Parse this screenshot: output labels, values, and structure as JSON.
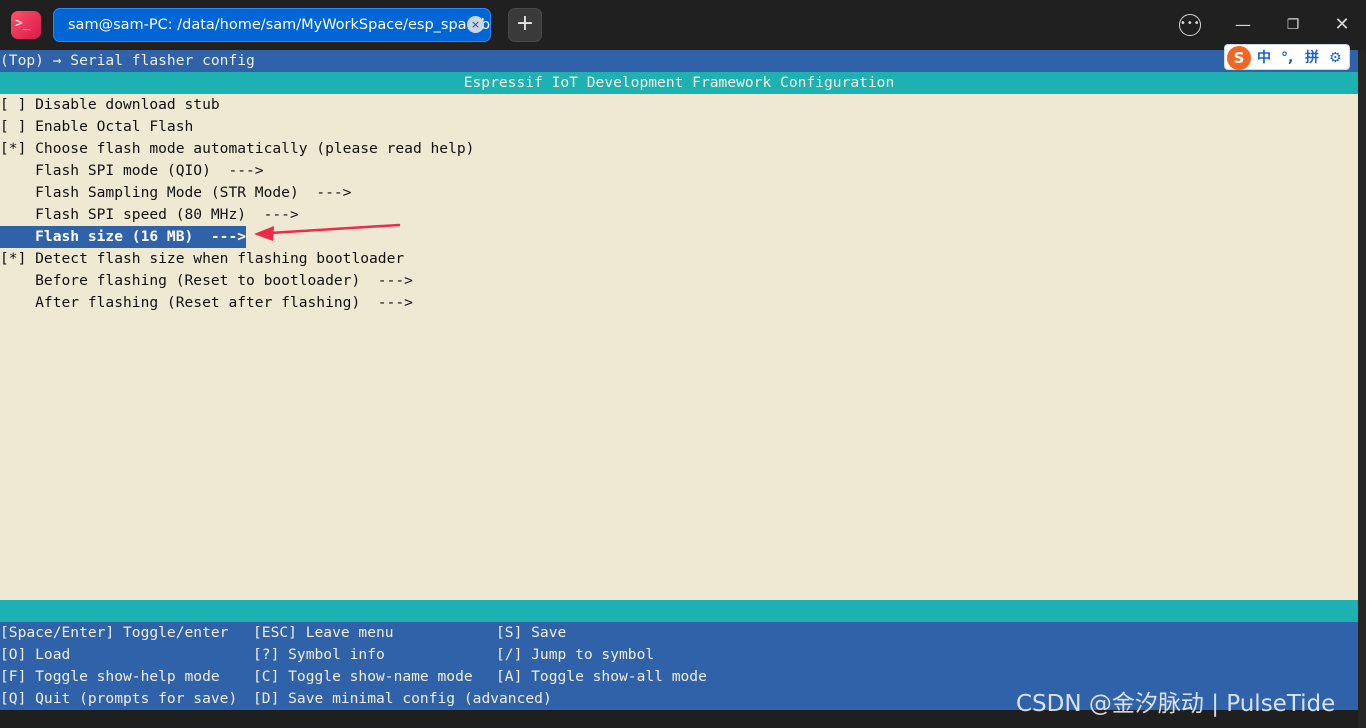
{
  "window": {
    "app_icon": "terminal-icon",
    "tab_title": "sam@sam-PC: /data/home/sam/MyWorkSpace/esp_sparkbo···",
    "tab_close": "×",
    "new_tab": "+",
    "more": "•••",
    "minimize": "—",
    "maximize": "❐",
    "close": "✕"
  },
  "ime": {
    "logo": "S",
    "mode": "中",
    "punct": "°,",
    "pinyin": "拼",
    "settings": "⚙"
  },
  "menuconfig": {
    "breadcrumb": "(Top) → Serial flasher config",
    "header": "Espressif IoT Development Framework Configuration",
    "items": [
      {
        "text": "[ ] Disable download stub",
        "selected": false
      },
      {
        "text": "[ ] Enable Octal Flash",
        "selected": false
      },
      {
        "text": "[*] Choose flash mode automatically (please read help)",
        "selected": false
      },
      {
        "text": "    Flash SPI mode (QIO)  --->",
        "selected": false
      },
      {
        "text": "    Flash Sampling Mode (STR Mode)  --->",
        "selected": false
      },
      {
        "text": "    Flash SPI speed (80 MHz)  --->",
        "selected": false
      },
      {
        "text": "    Flash size (16 MB)  --->",
        "selected": true
      },
      {
        "text": "[*] Detect flash size when flashing bootloader",
        "selected": false
      },
      {
        "text": "    Before flashing (Reset to bootloader)  --->",
        "selected": false
      },
      {
        "text": "    After flashing (Reset after flashing)  --->",
        "selected": false
      }
    ],
    "keys": [
      [
        "[Space/Enter] Toggle/enter",
        "[ESC] Leave menu",
        "[S] Save"
      ],
      [
        "[O] Load",
        "[?] Symbol info",
        "[/] Jump to symbol"
      ],
      [
        "[F] Toggle show-help mode",
        "[C] Toggle show-name mode",
        "[A] Toggle show-all mode"
      ],
      [
        "[Q] Quit (prompts for save)",
        "[D] Save minimal config (advanced)",
        ""
      ]
    ]
  },
  "watermark": "CSDN @金汐脉动 | PulseTide",
  "colors": {
    "selection": "#2f62a8",
    "header": "#1eb1b1",
    "background": "#efe8d3",
    "annotation_arrow": "#ee2a4a"
  }
}
